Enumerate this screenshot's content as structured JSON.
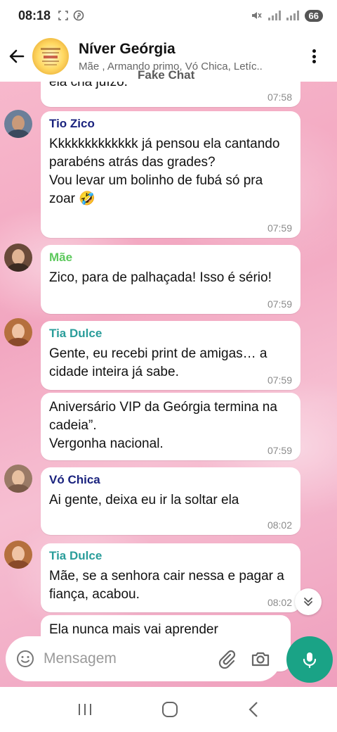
{
  "status_bar": {
    "time": "08:18",
    "battery": "66"
  },
  "header": {
    "title": "Níver Geórgia",
    "subtitle": "Mãe , Armando primo, Vó Chica, Letíc..",
    "watermark": "Fake Chat"
  },
  "messages": [
    {
      "sender": "",
      "text": "ela cria juízo.",
      "time": "07:58"
    },
    {
      "sender": "Tio Zico",
      "text": "Kkkkkkkkkkkkk já pensou ela cantando parabéns atrás das grades?\nVou levar um bolinho de fubá só pra zoar 🤣",
      "time": "07:59"
    },
    {
      "sender": "Mãe",
      "text": "Zico, para de palhaçada! Isso é sério!",
      "time": "07:59"
    },
    {
      "sender": "Tia Dulce",
      "text": "Gente, eu recebi print de amigas… a cidade inteira já sabe.",
      "time": "07:59"
    },
    {
      "sender": "",
      "text": "Aniversário VIP da Geórgia termina na cadeia”.\nVergonha nacional.",
      "time": "07:59"
    },
    {
      "sender": "Vó Chica",
      "text": "Ai gente, deixa eu ir la soltar ela",
      "time": "08:02"
    },
    {
      "sender": "Tia Dulce",
      "text": "Mãe, se a senhora cair nessa e pagar a fiança, acabou.",
      "time": "08:02"
    },
    {
      "sender": "",
      "text": "Ela nunca mais vai aprender",
      "time": ""
    }
  ],
  "input": {
    "placeholder": "Mensagem"
  },
  "colors": {
    "accent": "#1aa386",
    "tio_zico": "#1a237e",
    "mae": "#5cc95c",
    "tia_dulce": "#2a9d9a",
    "vo_chica": "#1a237e"
  },
  "icons": [
    "back-arrow-icon",
    "more-vertical-icon",
    "emoji-icon",
    "attach-icon",
    "camera-icon",
    "mic-icon",
    "chevron-double-down-icon",
    "recent-apps-icon",
    "home-icon",
    "back-nav-icon"
  ]
}
